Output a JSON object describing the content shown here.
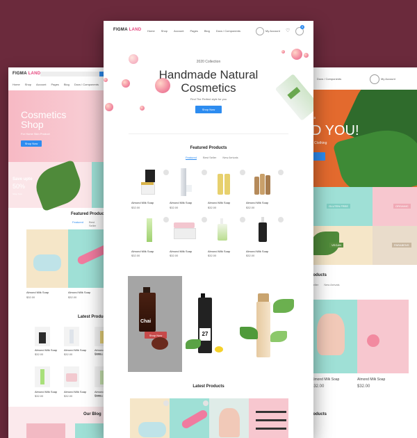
{
  "center": {
    "logo": {
      "word1": "FIGMA",
      "word2": "LAND"
    },
    "nav": [
      "Home",
      "Shop",
      "Account",
      "Pages",
      "Blog",
      "Docs / Components"
    ],
    "account_label": "My Account",
    "cart_count": "0",
    "hero": {
      "eyebrow": "2020 Collection",
      "title_line1": "Handmade Natural",
      "title_line2": "Cosmetics",
      "subtitle": "Find The Perfect style for you",
      "cta": "Shop Now"
    },
    "featured": {
      "title": "Featured Products",
      "tabs": [
        "Featured",
        "Best Seller",
        "New Arrivals"
      ],
      "products": [
        {
          "name": "Almond Milk Soap",
          "price": "$32.00"
        },
        {
          "name": "Almond Milk Soap",
          "price": "$32.00"
        },
        {
          "name": "Almond Milk Soap",
          "price": "$32.00"
        },
        {
          "name": "Almond Milk Soap",
          "price": "$32.00"
        },
        {
          "name": "Almond Milk Soap",
          "price": "$32.00"
        },
        {
          "name": "Almond Milk Soap",
          "price": "$32.00"
        },
        {
          "name": "Almond Milk Soap",
          "price": "$32.00"
        },
        {
          "name": "Almond Milk Soap",
          "price": "$32.00"
        }
      ]
    },
    "promo": {
      "bottle_label": "Chai",
      "bottle_number": "27",
      "cta": "Shop Now"
    },
    "latest_title": "Latest Products"
  },
  "left": {
    "logo": {
      "word1": "FIGMA",
      "word2": "LAND"
    },
    "nav": [
      "Home",
      "Shop",
      "Account",
      "Pages",
      "Blog",
      "Docs / Components"
    ],
    "hero": {
      "title_line1": "Cosmetics",
      "title_line2": "Shop",
      "subtitle": "For Home Skin Product",
      "cta": "Shop Now"
    },
    "promo": {
      "label": "Save upto",
      "value": "50%",
      "link": "Shop Now"
    },
    "featured_title": "Featured Products",
    "tabs": [
      "Featured",
      "Best Seller",
      "New"
    ],
    "big_products": [
      {
        "name": "Almond Milk Soap",
        "price": "$32.00"
      },
      {
        "name": "Almond Milk Soap",
        "price": "$32.00"
      }
    ],
    "latest_title": "Latest Products",
    "small_products": [
      {
        "name": "Almond Milk Soap",
        "price": "$32.00"
      },
      {
        "name": "Almond Milk Soap",
        "price": "$32.00"
      },
      {
        "name": "Almond Milk Soap",
        "price": "$32.00"
      },
      {
        "name": "Almond Milk Soap",
        "price": "$32.00"
      },
      {
        "name": "Almond Milk Soap",
        "price": "$32.00"
      },
      {
        "name": "Almond Milk Soap",
        "price": "$32.00"
      }
    ],
    "blog_title": "Our Blog"
  },
  "right": {
    "nav_label": "Docs / Components",
    "account_label": "My Account",
    "hero_small": "ics",
    "hero_big": "D YOU!",
    "hero_sub": "Clothing",
    "categories": [
      "GLUTEN FREE",
      "ORGANIC",
      "VEGAN",
      "PARABENS"
    ],
    "section_title": "roducts",
    "tabs": [
      "Seller",
      "New Arrivals"
    ],
    "products": [
      {
        "name": "Almond Milk Soap",
        "price": "$32.00"
      },
      {
        "name": "Almond Milk Soap",
        "price": "$32.00"
      }
    ],
    "section2_title": "roducts"
  },
  "colors": {
    "background": "#6b2a3c",
    "accent_blue": "#2d8cf0",
    "pink": "#f7c7cf",
    "teal": "#9fe0d6",
    "orange": "#e36a2e"
  }
}
